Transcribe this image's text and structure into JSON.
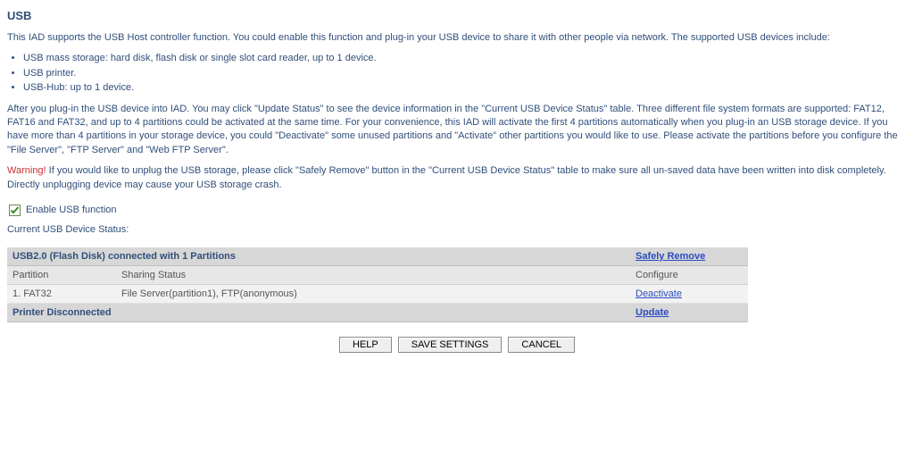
{
  "title": "USB",
  "intro": "This IAD supports the USB Host controller function. You could enable this function and plug-in your USB device to share it with other people via network. The supported USB devices include:",
  "supported": [
    "USB mass storage: hard disk, flash disk or single slot card reader, up to 1 device.",
    "USB printer.",
    "USB-Hub: up to 1 device."
  ],
  "after_plug": "After you plug-in the USB device into IAD. You may click \"Update Status\" to see the device information in the \"Current USB Device Status\" table. Three different file system formats are supported: FAT12, FAT16 and FAT32, and up to 4 partitions could be activated at the same time. For your convenience, this IAD will activate the first 4 partitions automatically when you plug-in an USB storage device. If you have more than 4 partitions in your storage device, you could \"Deactivate\" some unused partitions and \"Activate\" other partitions you would like to use. Please activate the partitions before you configure the \"File Server\", \"FTP Server\" and \"Web FTP Server\".",
  "warning_label": "Warning!",
  "warning_text": " If you would like to unplug the USB storage, please click \"Safely Remove\" button in the \"Current USB Device Status\" table to make sure all un-saved data have been written into disk completely. Directly unplugging device may cause your USB storage crash.",
  "enable_label": "Enable USB function",
  "status_heading": "Current USB Device Status:",
  "device_header": "USB2.0 (Flash Disk) connected with 1 Partitions",
  "safely_remove": "Safely Remove",
  "columns": {
    "partition": "Partition",
    "sharing": "Sharing Status",
    "configure": "Configure"
  },
  "rows": [
    {
      "partition": "1. FAT32",
      "sharing": "File Server(partition1), FTP(anonymous)",
      "action": "Deactivate"
    }
  ],
  "printer_header": "Printer Disconnected",
  "update": "Update",
  "buttons": {
    "help": "HELP",
    "save": "SAVE SETTINGS",
    "cancel": "CANCEL"
  }
}
